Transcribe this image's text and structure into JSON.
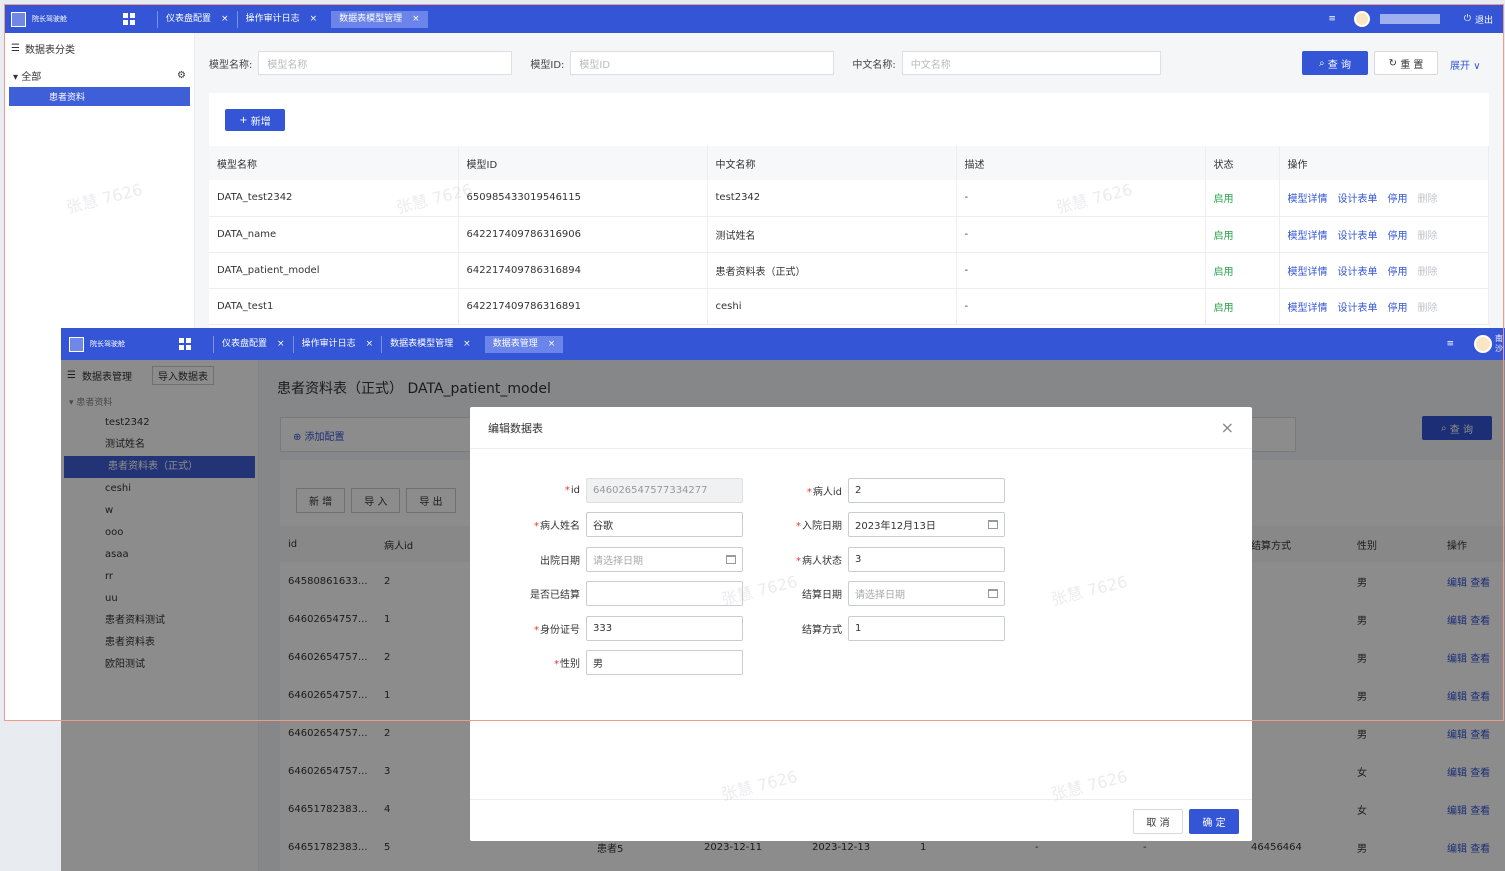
{
  "back": {
    "logo": "院长驾驶舱",
    "tabs": [
      {
        "label": "仪表盘配置"
      },
      {
        "label": "操作审计日志"
      },
      {
        "label": "数据表模型管理"
      }
    ],
    "right": {
      "menu_icon": "≡",
      "logout": "退出"
    },
    "sidebar": {
      "title": "数据表分类",
      "root": "全部",
      "selected": "患者资料"
    },
    "search": {
      "model_name_label": "模型名称:",
      "model_name_ph": "模型名称",
      "model_id_label": "模型ID:",
      "model_id_ph": "模型ID",
      "cn_name_label": "中文名称:",
      "cn_name_ph": "中文名称",
      "query": "查 询",
      "reset": "重 置",
      "expand": "展开"
    },
    "add": "新增",
    "columns": [
      "模型名称",
      "模型ID",
      "中文名称",
      "描述",
      "状态",
      "操作"
    ],
    "rows": [
      {
        "name": "DATA_test2342",
        "id": "650985433019546115",
        "cn": "test2342",
        "desc": "-",
        "status": "启用"
      },
      {
        "name": "DATA_name",
        "id": "642217409786316906",
        "cn": "测试姓名",
        "desc": "-",
        "status": "启用"
      },
      {
        "name": "DATA_patient_model",
        "id": "642217409786316894",
        "cn": "患者资料表（正式）",
        "desc": "-",
        "status": "启用"
      },
      {
        "name": "DATA_test1",
        "id": "642217409786316891",
        "cn": "ceshi",
        "desc": "-",
        "status": "启用"
      }
    ],
    "ops": [
      "模型详情",
      "设计表单",
      "停用",
      "删除"
    ]
  },
  "front": {
    "logo": "院长驾驶舱",
    "tabs": [
      {
        "label": "仪表盘配置"
      },
      {
        "label": "操作审计日志"
      },
      {
        "label": "数据表模型管理"
      },
      {
        "label": "数据表管理"
      }
    ],
    "right": {
      "menu_icon": "≡",
      "name": "南沙"
    },
    "sidebar": {
      "title": "数据表管理",
      "import": "导入数据表",
      "group": "患者资料",
      "items": [
        "test2342",
        "测试姓名",
        "患者资料表（正式）",
        "ceshi",
        "w",
        "ooo",
        "asaa",
        "rr",
        "uu",
        "患者资料测试",
        "患者资料表",
        "欧阳测试"
      ],
      "selected_index": 2
    },
    "heading": "患者资料表（正式） DATA_patient_model",
    "add_config": "⊕ 添加配置",
    "query": "查 询",
    "btns": [
      "新 增",
      "导 入",
      "导 出"
    ],
    "columns": {
      "id": "id",
      "patient_id": "病人id",
      "settle_way": "结算方式",
      "gender": "性别",
      "op": "操作"
    },
    "rows": [
      {
        "id": "64580861633...",
        "pid": "2",
        "gender": "男"
      },
      {
        "id": "64602654757...",
        "pid": "1",
        "gender": "男"
      },
      {
        "id": "64602654757...",
        "pid": "2",
        "gender": "男"
      },
      {
        "id": "64602654757...",
        "pid": "1",
        "gender": "男"
      },
      {
        "id": "64602654757...",
        "pid": "2",
        "gender": "男"
      },
      {
        "id": "64602654757...",
        "pid": "3",
        "gender": "女"
      },
      {
        "id": "64651782383...",
        "pid": "4",
        "gender": "女"
      },
      {
        "id": "64651782383...",
        "pid": "5",
        "gender": "男",
        "name": "患者5",
        "in": "2023-12-11",
        "out": "2023-12-13",
        "st": "1",
        "d1": "-",
        "d2": "-",
        "card": "46456464",
        "d3": "-"
      }
    ],
    "ops": {
      "edit": "编辑",
      "view": "查看"
    }
  },
  "dialog": {
    "title": "编辑数据表",
    "fields": {
      "id": {
        "label": "id",
        "value": "646026547577334277",
        "req": true
      },
      "patient_id": {
        "label": "病人id",
        "value": "2",
        "req": true
      },
      "patient_name": {
        "label": "病人姓名",
        "value": "谷歌",
        "req": true
      },
      "admit_date": {
        "label": "入院日期",
        "value": "2023年12月13日",
        "req": true
      },
      "discharge_date": {
        "label": "出院日期",
        "placeholder": "请选择日期",
        "req": false
      },
      "patient_status": {
        "label": "病人状态",
        "value": "3",
        "req": true
      },
      "settled": {
        "label": "是否已结算",
        "value": "",
        "req": false
      },
      "settle_date": {
        "label": "结算日期",
        "placeholder": "请选择日期",
        "req": false
      },
      "id_card": {
        "label": "身份证号",
        "value": "333",
        "req": true
      },
      "settle_way": {
        "label": "结算方式",
        "value": "1",
        "req": false
      },
      "gender": {
        "label": "性别",
        "value": "男",
        "req": true
      }
    },
    "cancel": "取 消",
    "ok": "确 定"
  },
  "watermark": "张慧 7626",
  "colors": {
    "primary": "#3355d6",
    "enabled": "#2aa64d",
    "required": "#e33333"
  }
}
